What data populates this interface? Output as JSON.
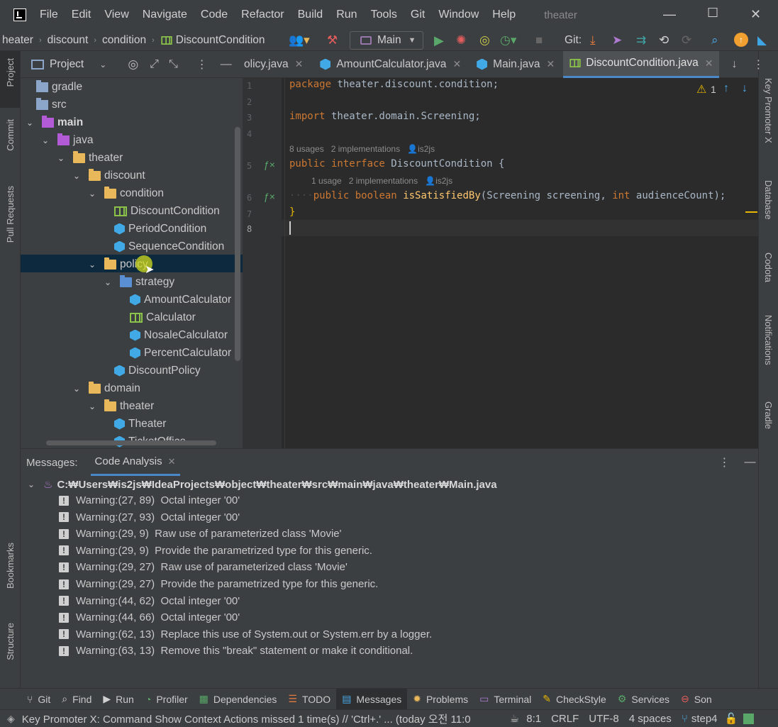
{
  "menu": {
    "items": [
      "File",
      "Edit",
      "View",
      "Navigate",
      "Code",
      "Refactor",
      "Build",
      "Run",
      "Tools",
      "Git",
      "Window",
      "Help"
    ],
    "title": "theater"
  },
  "navbar": {
    "breadcrumbs": [
      "heater",
      "discount",
      "condition",
      "DiscountCondition"
    ],
    "run_config": "Main",
    "git_label": "Git:"
  },
  "left_strip": {
    "top": [
      "Project",
      "Commit",
      "Pull Requests"
    ],
    "bottom": [
      "Bookmarks",
      "Structure"
    ]
  },
  "right_strip": [
    "Key Promoter X",
    "Database",
    "Codota",
    "Notifications",
    "Gradle"
  ],
  "project": {
    "header": "Project",
    "tree": [
      {
        "label": "gradle",
        "icon": "folder-gray",
        "depth": 0,
        "arrow": ""
      },
      {
        "label": "src",
        "icon": "folder-gray",
        "depth": 0,
        "arrow": ""
      },
      {
        "label": "main",
        "icon": "folder-purple",
        "depth": 0,
        "arrow": "v",
        "bold": true
      },
      {
        "label": "java",
        "icon": "folder-purple",
        "depth": 1,
        "arrow": "v"
      },
      {
        "label": "theater",
        "icon": "folder",
        "depth": 2,
        "arrow": "v"
      },
      {
        "label": "discount",
        "icon": "folder",
        "depth": 3,
        "arrow": "v"
      },
      {
        "label": "condition",
        "icon": "folder",
        "depth": 4,
        "arrow": "v"
      },
      {
        "label": "DiscountCondition",
        "icon": "interface",
        "depth": 5,
        "arrow": ""
      },
      {
        "label": "PeriodCondition",
        "icon": "class",
        "depth": 5,
        "arrow": ""
      },
      {
        "label": "SequenceCondition",
        "icon": "class",
        "depth": 5,
        "arrow": ""
      },
      {
        "label": "policy",
        "icon": "folder",
        "depth": 4,
        "arrow": "v"
      },
      {
        "label": "strategy",
        "icon": "folder-blue",
        "depth": 5,
        "arrow": "v"
      },
      {
        "label": "AmountCalculator",
        "icon": "class",
        "depth": 6,
        "arrow": ""
      },
      {
        "label": "Calculator",
        "icon": "interface",
        "depth": 6,
        "arrow": ""
      },
      {
        "label": "NosaleCalculator",
        "icon": "class",
        "depth": 6,
        "arrow": ""
      },
      {
        "label": "PercentCalculator",
        "icon": "class",
        "depth": 6,
        "arrow": ""
      },
      {
        "label": "DiscountPolicy",
        "icon": "class",
        "depth": 5,
        "arrow": ""
      },
      {
        "label": "domain",
        "icon": "folder",
        "depth": 3,
        "arrow": "v"
      },
      {
        "label": "theater",
        "icon": "folder",
        "depth": 4,
        "arrow": "v"
      },
      {
        "label": "Theater",
        "icon": "class",
        "depth": 5,
        "arrow": ""
      },
      {
        "label": "TicketOffice",
        "icon": "class",
        "depth": 5,
        "arrow": ""
      }
    ]
  },
  "editor_tabs": [
    {
      "label": "olicy.java",
      "icon": "",
      "active": false
    },
    {
      "label": "AmountCalculator.java",
      "icon": "class",
      "active": false
    },
    {
      "label": "Main.java",
      "icon": "class",
      "active": false
    },
    {
      "label": "DiscountCondition.java",
      "icon": "interface",
      "active": true
    }
  ],
  "editor": {
    "warning_count": "1",
    "line_numbers": [
      "1",
      "2",
      "3",
      "4",
      "5",
      "6",
      "7",
      "8"
    ],
    "line1": {
      "kw": "package",
      "rest": " theater.discount.condition;"
    },
    "line3": {
      "kw": "import",
      "rest": " theater.domain.Screening;"
    },
    "hint1": {
      "usages": "8 usages",
      "impl": "2 implementations",
      "author": "is2js"
    },
    "line5": {
      "kw": "public interface",
      "rest": " DiscountCondition {"
    },
    "hint2": {
      "usages": "1 usage",
      "impl": "2 implementations",
      "author": "is2js"
    },
    "line6": {
      "indent": "····",
      "kw1": "public",
      "kw2": "boolean",
      "fn": "isSatisfiedBy",
      "p1": "(Screening screening, ",
      "kw3": "int",
      "p2": " audienceCount);"
    },
    "line7": "}"
  },
  "bottom": {
    "tabs": [
      "Messages:",
      "Code Analysis"
    ],
    "file_path": "C:₩Users₩is2js₩IdeaProjects₩object₩theater₩src₩main₩java₩theater₩Main.java",
    "warnings": [
      "Warning:(27, 89)  Octal integer '00'",
      "Warning:(27, 93)  Octal integer '00'",
      "Warning:(29, 9)  Raw use of parameterized class 'Movie'",
      "Warning:(29, 9)  Provide the parametrized type for this generic.",
      "Warning:(29, 27)  Raw use of parameterized class 'Movie'",
      "Warning:(29, 27)  Provide the parametrized type for this generic.",
      "Warning:(44, 62)  Octal integer '00'",
      "Warning:(44, 66)  Octal integer '00'",
      "Warning:(62, 13)  Replace this use of System.out or System.err by a logger.",
      "Warning:(63, 13)  Remove this \"break\" statement or make it conditional."
    ]
  },
  "tool_windows": [
    {
      "label": "Git",
      "icon": "git-icon",
      "glyph": "⑂",
      "active": false
    },
    {
      "label": "Find",
      "icon": "find-icon",
      "glyph": "⌕",
      "active": false
    },
    {
      "label": "Run",
      "icon": "run-icon",
      "glyph": "▶",
      "active": false
    },
    {
      "label": "Profiler",
      "icon": "profiler-icon",
      "glyph": "◔",
      "active": false
    },
    {
      "label": "Dependencies",
      "icon": "dependencies-icon",
      "glyph": "▦",
      "active": false
    },
    {
      "label": "TODO",
      "icon": "todo-icon",
      "glyph": "☰",
      "active": false
    },
    {
      "label": "Messages",
      "icon": "messages-icon",
      "glyph": "▤",
      "active": true
    },
    {
      "label": "Problems",
      "icon": "problems-icon",
      "glyph": "✹",
      "active": false
    },
    {
      "label": "Terminal",
      "icon": "terminal-icon",
      "glyph": "▭",
      "active": false
    },
    {
      "label": "CheckStyle",
      "icon": "checkstyle-icon",
      "glyph": "✎",
      "active": false
    },
    {
      "label": "Services",
      "icon": "services-icon",
      "glyph": "⚙",
      "active": false
    },
    {
      "label": "Son",
      "icon": "sonar-icon",
      "glyph": "⊖",
      "active": false
    }
  ],
  "status": {
    "message": "Key Promoter X: Command Show Context Actions missed 1 time(s) // 'Ctrl+.' ... (today 오전 11:0",
    "position": "8:1",
    "line_sep": "CRLF",
    "encoding": "UTF-8",
    "indent": "4 spaces",
    "branch": "step4"
  },
  "colors": {
    "accent": "#4a88c7",
    "keyword": "#cc7832",
    "function": "#ffc66d",
    "warning": "#e8b600",
    "run_green": "#59a869",
    "debug_red": "#e45d5d"
  }
}
